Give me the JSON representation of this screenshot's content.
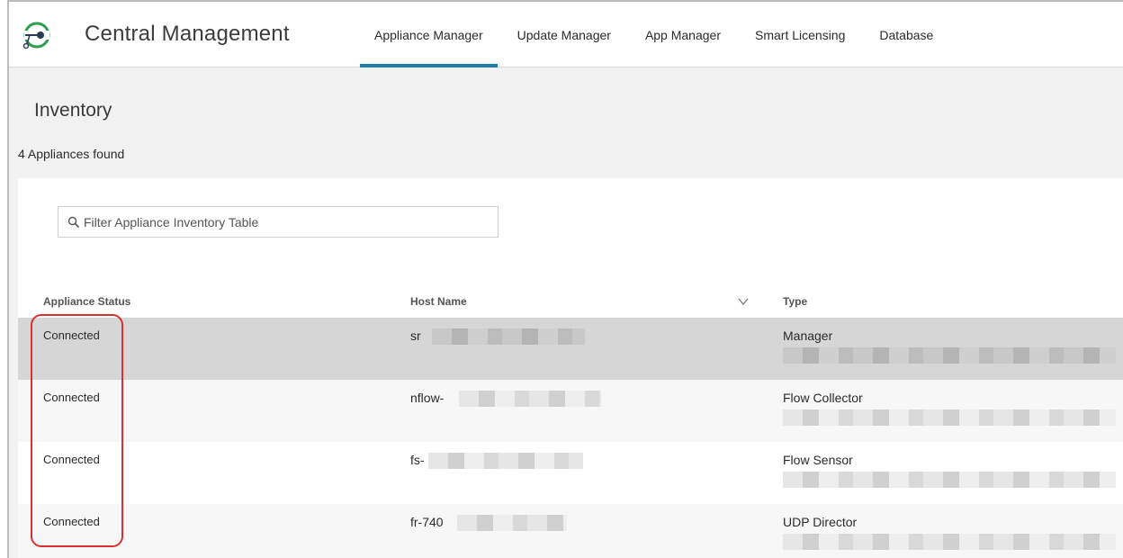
{
  "header": {
    "app_title": "Central Management",
    "logo": "cisco-logo-icon",
    "nav": [
      {
        "label": "Appliance Manager",
        "active": true
      },
      {
        "label": "Update Manager",
        "active": false
      },
      {
        "label": "App Manager",
        "active": false
      },
      {
        "label": "Smart Licensing",
        "active": false
      },
      {
        "label": "Database",
        "active": false
      }
    ],
    "accent_color": "#1d7ea6"
  },
  "page": {
    "title": "Inventory",
    "count_text": "4 Appliances found"
  },
  "search": {
    "placeholder": "Filter Appliance Inventory Table",
    "icon": "search-icon"
  },
  "table": {
    "columns": [
      "Appliance Status",
      "Host Name",
      "Type"
    ],
    "sort_icon": "chevron-down-icon",
    "rows": [
      {
        "status": "Connected",
        "host": "sr",
        "type": "Manager"
      },
      {
        "status": "Connected",
        "host": "nflow-",
        "type": "Flow Collector"
      },
      {
        "status": "Connected",
        "host": "fs-",
        "type": "Flow Sensor"
      },
      {
        "status": "Connected",
        "host": "fr-740",
        "type": "UDP Director"
      }
    ]
  },
  "annotation_color": "#d93030"
}
